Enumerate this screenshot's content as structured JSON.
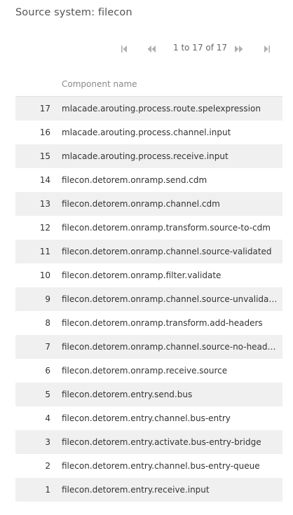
{
  "title": "Source system: filecon",
  "pagination": {
    "info": "1 to 17 of 17",
    "first_icon": "first-page-icon",
    "prev_icon": "previous-page-icon",
    "next_icon": "next-page-icon",
    "last_icon": "last-page-icon"
  },
  "table": {
    "columns": [
      "",
      "Component name"
    ],
    "rows": [
      {
        "num": "17",
        "name": "mlacade.arouting.process.route.spelexpression"
      },
      {
        "num": "16",
        "name": "mlacade.arouting.process.channel.input"
      },
      {
        "num": "15",
        "name": "mlacade.arouting.process.receive.input"
      },
      {
        "num": "14",
        "name": "filecon.detorem.onramp.send.cdm"
      },
      {
        "num": "13",
        "name": "filecon.detorem.onramp.channel.cdm"
      },
      {
        "num": "12",
        "name": "filecon.detorem.onramp.transform.source-to-cdm"
      },
      {
        "num": "11",
        "name": "filecon.detorem.onramp.channel.source-validated"
      },
      {
        "num": "10",
        "name": "filecon.detorem.onramp.filter.validate"
      },
      {
        "num": "9",
        "name": "filecon.detorem.onramp.channel.source-unvalidat..."
      },
      {
        "num": "8",
        "name": "filecon.detorem.onramp.transform.add-headers"
      },
      {
        "num": "7",
        "name": "filecon.detorem.onramp.channel.source-no-headers"
      },
      {
        "num": "6",
        "name": "filecon.detorem.onramp.receive.source"
      },
      {
        "num": "5",
        "name": "filecon.detorem.entry.send.bus"
      },
      {
        "num": "4",
        "name": "filecon.detorem.entry.channel.bus-entry"
      },
      {
        "num": "3",
        "name": "filecon.detorem.entry.activate.bus-entry-bridge"
      },
      {
        "num": "2",
        "name": "filecon.detorem.entry.channel.bus-entry-queue"
      },
      {
        "num": "1",
        "name": "filecon.detorem.entry.receive.input"
      }
    ]
  },
  "colors": {
    "row_alt": "#f0f0f0",
    "icon": "#b0b0b0",
    "text": "#333333"
  }
}
